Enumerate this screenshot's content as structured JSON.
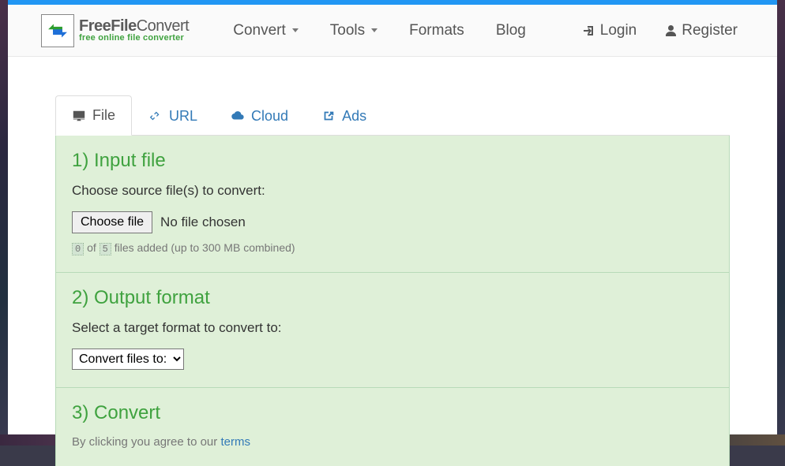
{
  "brand": {
    "title_bold": "FreeFile",
    "title_thin": "Convert",
    "subtitle": "free online file converter"
  },
  "nav": {
    "convert": "Convert",
    "tools": "Tools",
    "formats": "Formats",
    "blog": "Blog",
    "login": "Login",
    "register": "Register"
  },
  "tabs": {
    "file": "File",
    "url": "URL",
    "cloud": "Cloud",
    "ads": "Ads"
  },
  "step1": {
    "heading": "1) Input file",
    "prompt": "Choose source file(s) to convert:",
    "choose_button": "Choose file",
    "no_file": "No file chosen",
    "count_current": "0",
    "count_of": "of",
    "count_max": "5",
    "count_suffix": "files added (up to 300 MB combined)"
  },
  "step2": {
    "heading": "2) Output format",
    "prompt": "Select a target format to convert to:",
    "select_label": "Convert files to:"
  },
  "step3": {
    "heading": "3) Convert",
    "agree_prefix": "By clicking you agree to our ",
    "terms": "terms"
  }
}
